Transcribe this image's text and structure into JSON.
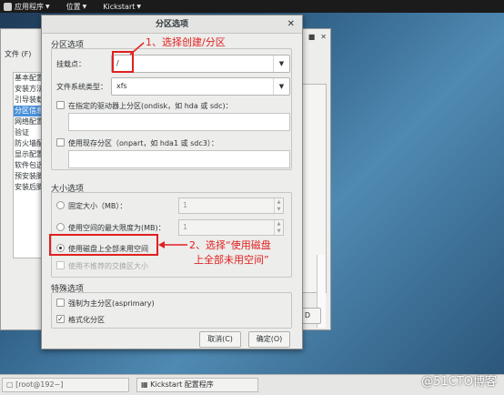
{
  "topbar": {
    "apps": "应用程序",
    "places": "位置",
    "app": "Kickstart"
  },
  "bg_window": {
    "menu_file": "文件 (F)",
    "sidebar": [
      "基本配置",
      "安装方法",
      "引导装载",
      "分区信息",
      "网络配置",
      "验证",
      "防火墙配",
      "显示配置",
      "软件包选",
      "预安装脚",
      "安装后脚"
    ],
    "sidebar_selected": 3,
    "btn_label": "D"
  },
  "dialog": {
    "title": "分区选项",
    "partition_section": "分区选项",
    "mount_label": "挂载点：",
    "mount_value": "/",
    "fs_label": "文件系统类型：",
    "fs_value": "xfs",
    "ondisk_label": "在指定的驱动器上分区(ondisk，如 hda 或 sdc)：",
    "onpart_label": "使用现存分区（onpart，如 hda1 或 sdc3）：",
    "size_section": "大小选项",
    "fixed_label": "固定大小（MB）：",
    "fixed_value": "1",
    "maxsize_label": "使用空间的最大限度为(MB)：",
    "maxsize_value": "1",
    "fill_label": "使用磁盘上全部未用空间",
    "recommended_swap": "使用不推荐的交换区大小",
    "special_section": "特殊选项",
    "primary_label": "强制为主分区(asprimary)",
    "format_label": "格式化分区",
    "cancel_label": "取消(C)",
    "ok_label": "确定(O)"
  },
  "annotations": {
    "step1": "1、选择创建/分区",
    "step2_line1": "2、选择“使用磁盘",
    "step2_line2": "上全部未用空间”"
  },
  "taskbar": {
    "terminal": "[root@192~]",
    "kickstart": "Kickstart 配置程序"
  },
  "watermark": "@51CTO博客",
  "colors": {
    "annotation": "#e02020",
    "selection": "#4a90d9"
  }
}
